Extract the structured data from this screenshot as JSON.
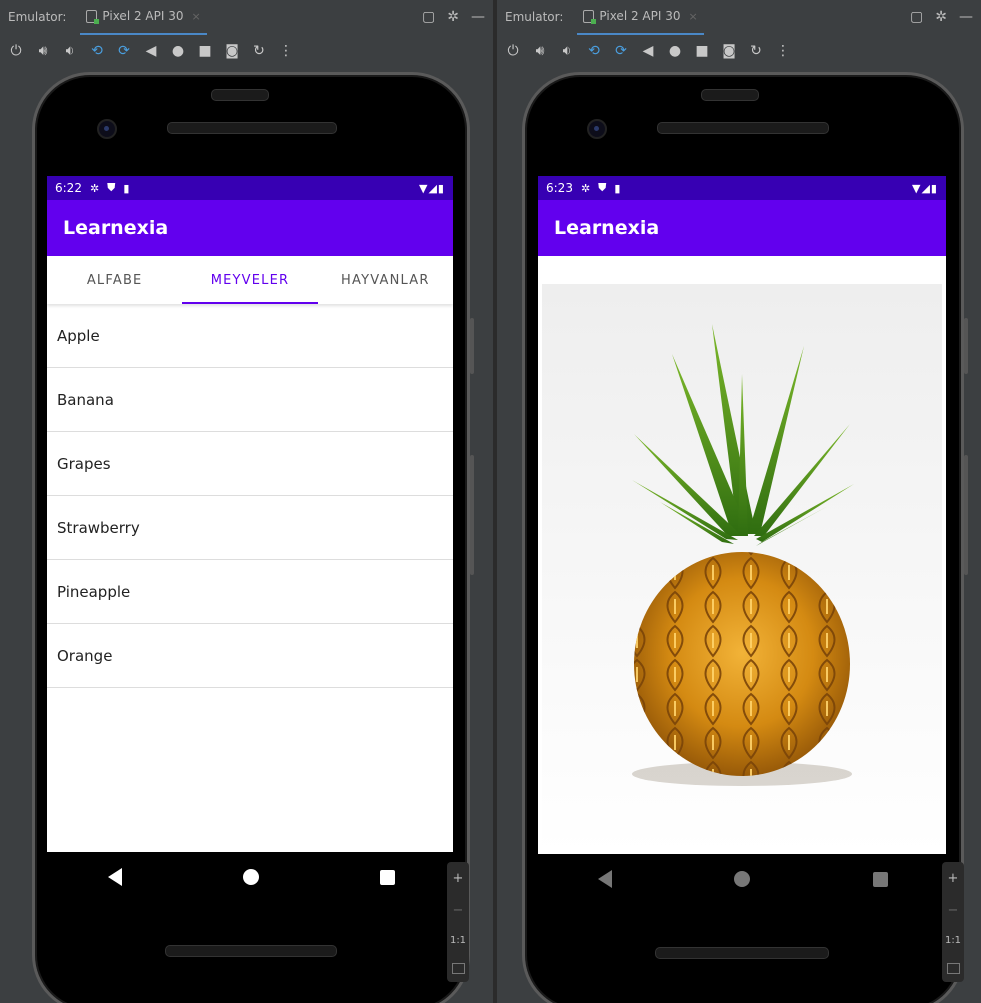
{
  "window": {
    "emulator_label": "Emulator:",
    "device_tab": "Pixel 2 API 30",
    "close_glyph": "×",
    "zoom": {
      "plus": "+",
      "minus": "−",
      "actual": "1:1"
    }
  },
  "left_screen": {
    "time": "6:22",
    "app_title": "Learnexia",
    "tabs": [
      {
        "label": "ALFABE",
        "active": false
      },
      {
        "label": "MEYVELER",
        "active": true
      },
      {
        "label": "HAYVANLAR",
        "active": false
      }
    ],
    "items": [
      "Apple",
      "Banana",
      "Grapes",
      "Strawberry",
      "Pineapple",
      "Orange"
    ]
  },
  "right_screen": {
    "time": "6:23",
    "app_title": "Learnexia",
    "image_subject": "pineapple"
  },
  "colors": {
    "primary": "#6200ee",
    "primary_dark": "#3700b3",
    "ide_background": "#3c3f41"
  }
}
